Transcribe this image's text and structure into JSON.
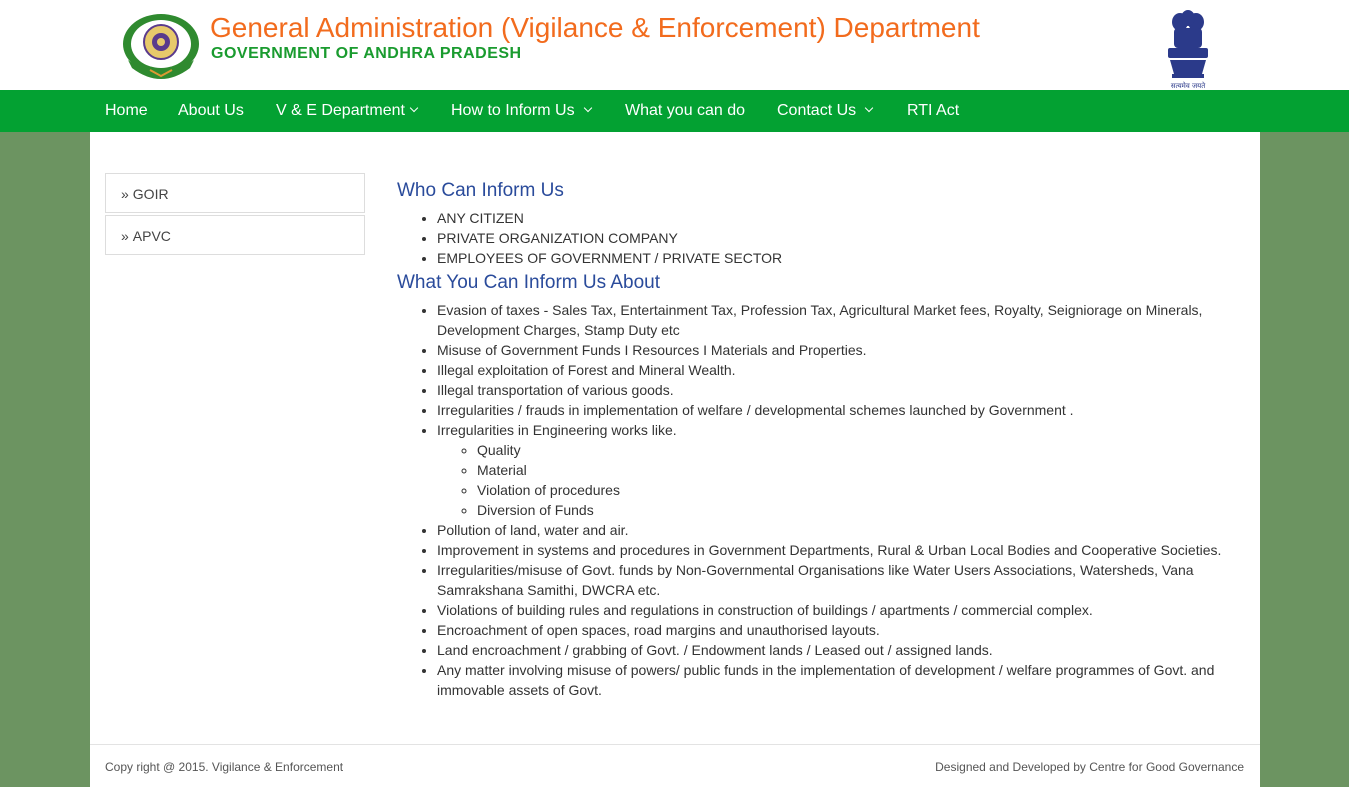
{
  "header": {
    "title": "General Administration (Vigilance & Enforcement) Department",
    "subtitle": "GOVERNMENT OF ANDHRA PRADESH",
    "logo_icon": "ap-government-seal-icon",
    "emblem_icon": "national-emblem-icon",
    "emblem_caption": "सत्यमेव जयते"
  },
  "colors": {
    "title": "#f26b1d",
    "subtitle": "#1a9b2f",
    "navbar": "#03a132",
    "page_background": "#6c9461",
    "heading": "#2a4b9b"
  },
  "nav": {
    "items": [
      {
        "label": "Home",
        "dropdown": false
      },
      {
        "label": "About Us",
        "dropdown": false
      },
      {
        "label": "V & E Department",
        "dropdown": true
      },
      {
        "label": "How to Inform Us",
        "dropdown": true
      },
      {
        "label": "What you can do",
        "dropdown": false
      },
      {
        "label": "Contact Us",
        "dropdown": true
      },
      {
        "label": "RTI Act",
        "dropdown": false
      }
    ]
  },
  "sidebar": {
    "items": [
      {
        "label": "GOIR"
      },
      {
        "label": "APVC"
      }
    ]
  },
  "content": {
    "section1": {
      "heading": "Who Can Inform Us",
      "items": [
        "ANY CITIZEN",
        "PRIVATE ORGANIZATION COMPANY",
        "EMPLOYEES OF GOVERNMENT / PRIVATE SECTOR"
      ]
    },
    "section2": {
      "heading": "What You Can Inform Us About",
      "items": [
        "Evasion of taxes - Sales Tax, Entertainment Tax, Profession Tax, Agricultural Market fees, Royalty, Seigniorage on Minerals, Development Charges, Stamp Duty etc",
        "Misuse of Government Funds I Resources I Materials and Properties.",
        "Illegal exploitation of Forest and Mineral Wealth.",
        "Illegal transportation of various goods.",
        "Irregularities / frauds in implementation of welfare / developmental schemes launched by Government .",
        "Irregularities in Engineering works like.",
        "Pollution of land, water and air.",
        "Improvement in systems and procedures in Government Departments, Rural & Urban Local Bodies and Cooperative Societies.",
        "Irregularities/misuse of Govt. funds by Non-Governmental Organisations like Water Users Associations, Watersheds, Vana Samrakshana Samithi, DWCRA etc.",
        "Violations of building rules and regulations in construction of buildings / apartments / commercial complex.",
        "Encroachment of open spaces, road margins and unauthorised layouts.",
        "Land encroachment / grabbing of Govt. / Endowment lands / Leased out / assigned lands.",
        "Any matter involving misuse of powers/ public funds in the implementation of development / welfare programmes of Govt. and immovable assets of Govt."
      ],
      "engineering_subitems": [
        "Quality",
        "Material",
        "Violation of procedures",
        "Diversion of Funds"
      ]
    }
  },
  "footer": {
    "copyright": "Copy right @ 2015. Vigilance & Enforcement",
    "credit": "Designed and Developed by Centre for Good Governance"
  }
}
